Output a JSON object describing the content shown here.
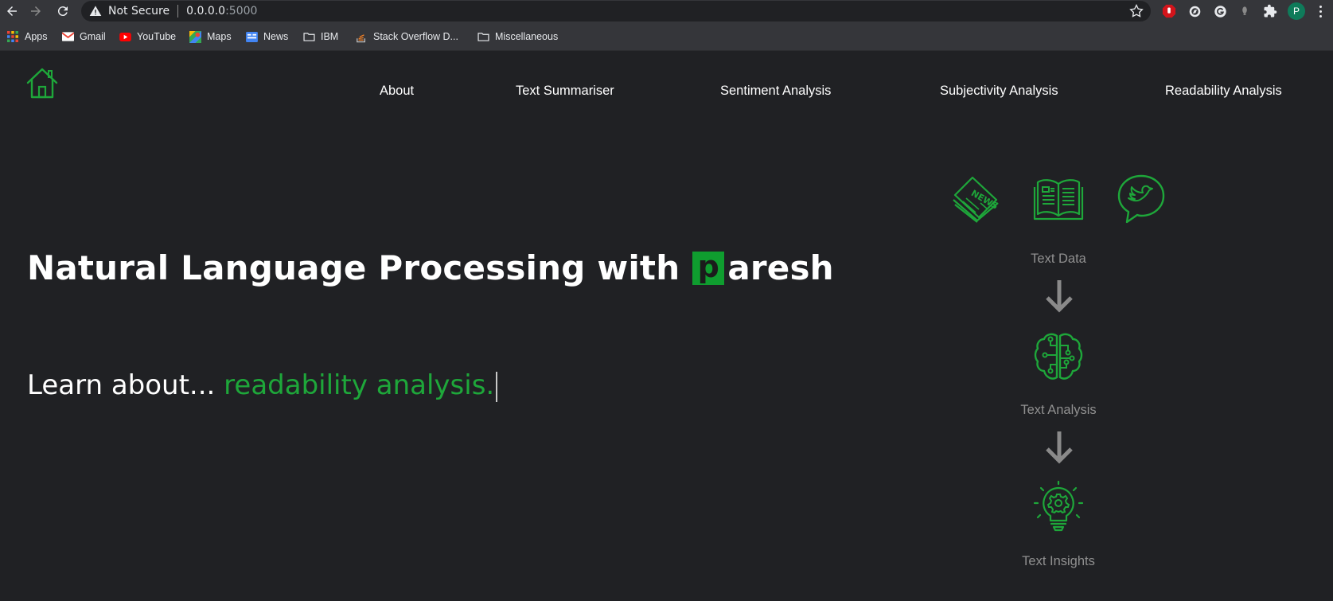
{
  "browser": {
    "security_text": "Not Secure",
    "url_host": "0.0.0.0",
    "url_port": ":5000",
    "profile_initial": "P",
    "bookmarks": [
      {
        "label": "Apps",
        "icon": "apps-grid-icon"
      },
      {
        "label": "Gmail",
        "icon": "gmail-icon"
      },
      {
        "label": "YouTube",
        "icon": "youtube-icon"
      },
      {
        "label": "Maps",
        "icon": "maps-icon"
      },
      {
        "label": "News",
        "icon": "news-icon"
      },
      {
        "label": "IBM",
        "icon": "folder-icon"
      },
      {
        "label": "Stack Overflow D...",
        "icon": "stackoverflow-icon"
      },
      {
        "label": "Miscellaneous",
        "icon": "folder-icon"
      }
    ]
  },
  "nav": {
    "links": [
      "About",
      "Text Summariser",
      "Sentiment Analysis",
      "Subjectivity Analysis",
      "Readability Analysis"
    ]
  },
  "hero": {
    "title_prefix": "Natural Language Processing with",
    "brand_letter": "p",
    "brand_rest": "aresh",
    "learn_prefix": "Learn about... ",
    "learn_topic": "readability analysis."
  },
  "flow": {
    "labels": [
      "Text Data",
      "Text Analysis",
      "Text Insights"
    ],
    "source_icons": [
      "newspaper-icon",
      "book-icon",
      "tweet-bubble-icon"
    ],
    "analysis_icon": "brain-circuit-icon",
    "insight_icon": "lightbulb-gear-icon"
  },
  "colors": {
    "accent": "#1ea73a",
    "background": "#202124",
    "muted_text": "#909090",
    "arrow": "#8a8a8a"
  }
}
